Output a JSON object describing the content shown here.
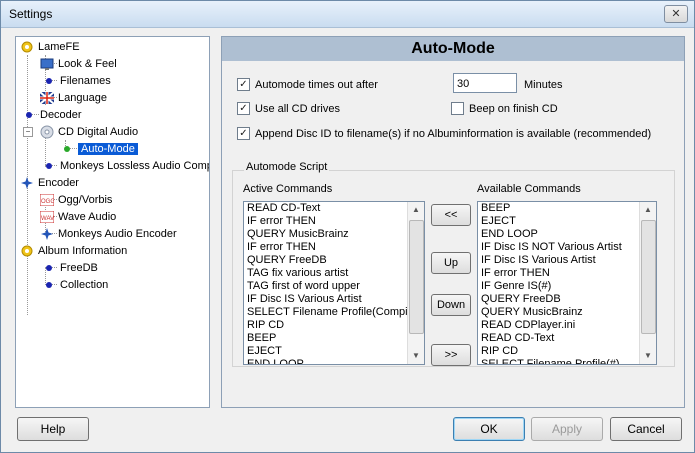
{
  "window": {
    "title": "Settings",
    "close_glyph": "✕"
  },
  "tree": {
    "root_lamefe": "LameFE",
    "look_feel": "Look & Feel",
    "filenames": "Filenames",
    "language": "Language",
    "decoder": "Decoder",
    "cd_digital_audio": "CD Digital Audio",
    "auto_mode": "Auto-Mode",
    "monkeys_lossless": "Monkeys Lossless Audio Compr",
    "encoder": "Encoder",
    "ogg_vorbis": "Ogg/Vorbis",
    "wave_audio": "Wave Audio",
    "monkeys_encoder": "Monkeys Audio Encoder",
    "album_information": "Album Information",
    "freedb": "FreeDB",
    "collection": "Collection"
  },
  "panel": {
    "heading": "Auto-Mode",
    "automode_timeout_label": "Automode times out after",
    "automode_timeout_value": "30",
    "minutes_label": "Minutes",
    "use_all_cd_label": "Use all CD drives",
    "beep_label": "Beep on finish CD",
    "append_disc_label": "Append Disc ID to filename(s) if no Albuminformation is available (recommended)",
    "script_group_label": "Automode Script",
    "active_label": "Active Commands",
    "available_label": "Available Commands",
    "active_commands": [
      "READ CD-Text",
      "IF error THEN",
      "QUERY MusicBrainz",
      "IF error THEN",
      "QUERY FreeDB",
      "TAG fix various artist",
      "TAG first of word upper",
      "IF Disc IS Various Artist",
      "SELECT Filename Profile(Compila",
      "RIP CD",
      "BEEP",
      "EJECT",
      "END LOOP"
    ],
    "available_commands": [
      "BEEP",
      "EJECT",
      "END LOOP",
      "IF Disc IS NOT Various Artist",
      "IF Disc IS Various Artist",
      "IF error THEN",
      "IF Genre IS(#)",
      "QUERY FreeDB",
      "QUERY MusicBrainz",
      "READ CDPlayer.ini",
      "READ CD-Text",
      "RIP CD",
      "SELECT Filename Profile(#)"
    ],
    "btn_move_left": "<<",
    "btn_up": "Up",
    "btn_down": "Down",
    "btn_move_right": ">>"
  },
  "checks": {
    "checked": "✓"
  },
  "footer": {
    "help": "Help",
    "ok": "OK",
    "apply": "Apply",
    "cancel": "Cancel"
  }
}
